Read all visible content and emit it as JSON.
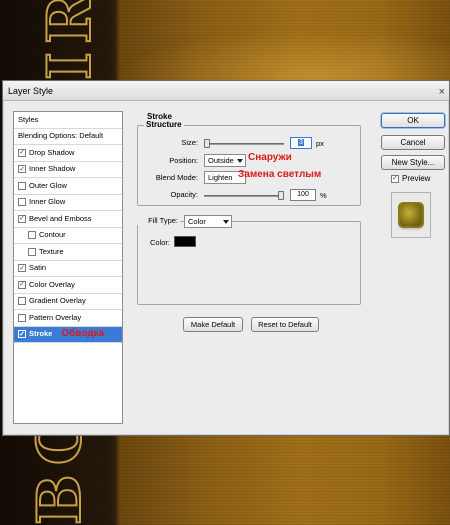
{
  "window": {
    "title": "Layer Style",
    "close_glyph": "×"
  },
  "styles_list": {
    "header": "Styles",
    "items": [
      {
        "label": "Blending Options: Default",
        "checkbox": false,
        "checked": false,
        "indent": false
      },
      {
        "label": "Drop Shadow",
        "checkbox": true,
        "checked": true,
        "indent": false
      },
      {
        "label": "Inner Shadow",
        "checkbox": true,
        "checked": true,
        "indent": false
      },
      {
        "label": "Outer Glow",
        "checkbox": true,
        "checked": false,
        "indent": false
      },
      {
        "label": "Inner Glow",
        "checkbox": true,
        "checked": false,
        "indent": false
      },
      {
        "label": "Bevel and Emboss",
        "checkbox": true,
        "checked": true,
        "indent": false
      },
      {
        "label": "Contour",
        "checkbox": true,
        "checked": false,
        "indent": true
      },
      {
        "label": "Texture",
        "checkbox": true,
        "checked": false,
        "indent": true
      },
      {
        "label": "Satin",
        "checkbox": true,
        "checked": true,
        "indent": false
      },
      {
        "label": "Color Overlay",
        "checkbox": true,
        "checked": true,
        "indent": false
      },
      {
        "label": "Gradient Overlay",
        "checkbox": true,
        "checked": false,
        "indent": false
      },
      {
        "label": "Pattern Overlay",
        "checkbox": true,
        "checked": false,
        "indent": false
      },
      {
        "label": "Stroke",
        "checkbox": true,
        "checked": true,
        "indent": false,
        "selected": true,
        "annotation": "Обводка"
      }
    ]
  },
  "stroke": {
    "group_title": "Stroke",
    "structure_title": "Structure",
    "size_label": "Size:",
    "size_value": "3",
    "size_unit": "px",
    "position_label": "Position:",
    "position_value": "Outside",
    "position_note": "Снаружи",
    "blend_label": "Blend Mode:",
    "blend_value": "Lighten",
    "blend_note": "Замена светлым",
    "opacity_label": "Opacity:",
    "opacity_value": "100",
    "opacity_unit": "%",
    "fill_type_label": "Fill Type:",
    "fill_type_value": "Color",
    "color_label": "Color:",
    "color_value": "#000000",
    "make_default": "Make Default",
    "reset_default": "Reset to Default"
  },
  "right_panel": {
    "ok": "OK",
    "cancel": "Cancel",
    "new_style": "New Style...",
    "preview_label": "Preview",
    "preview_checked": true
  },
  "colors": {
    "selection": "#3a7bd5",
    "annotation_red": "#d81b1b",
    "dialog_bg": "#ececec"
  }
}
